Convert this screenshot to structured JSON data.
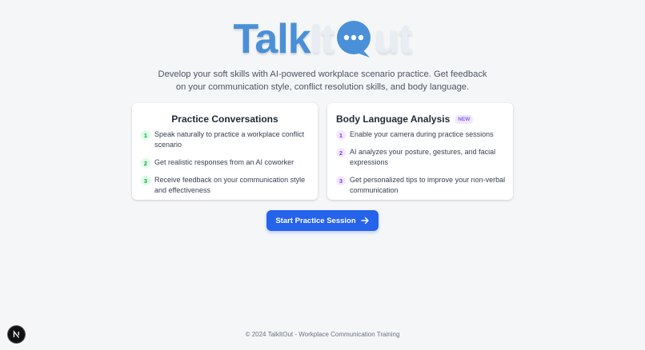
{
  "logo": {
    "part1": "Talk",
    "part2": "It",
    "part3": "ut",
    "bubble_icon": "chat-bubble-icon",
    "colors": {
      "talk": "#4a90d9",
      "bubble": "#4a90d9"
    }
  },
  "tagline": {
    "line1": "Develop your soft skills with AI-powered workplace scenario practice. Get feedback",
    "line2": "on your communication style, conflict resolution skills, and body language."
  },
  "cards": [
    {
      "title": "Practice Conversations",
      "steps": [
        {
          "num": "1",
          "text": "Speak naturally to practice a workplace conflict scenario"
        },
        {
          "num": "2",
          "text": "Get realistic responses from an AI coworker"
        },
        {
          "num": "3",
          "text": "Receive feedback on your communication style and effectiveness"
        }
      ]
    },
    {
      "title": "Body Language Analysis",
      "badge": "NEW",
      "steps": [
        {
          "num": "1",
          "text": "Enable your camera during practice sessions"
        },
        {
          "num": "2",
          "text": "AI analyzes your posture, gestures, and facial expressions"
        },
        {
          "num": "3",
          "text": "Get personalized tips to improve your non-verbal communication"
        }
      ]
    }
  ],
  "cta": {
    "label": "Start Practice Session",
    "icon": "arrow-right-icon",
    "color": "#2563eb"
  },
  "footer": "© 2024 TalkItOut - Workplace Communication Training",
  "dev_button": {
    "label": "N",
    "icon": "nextjs-icon"
  }
}
